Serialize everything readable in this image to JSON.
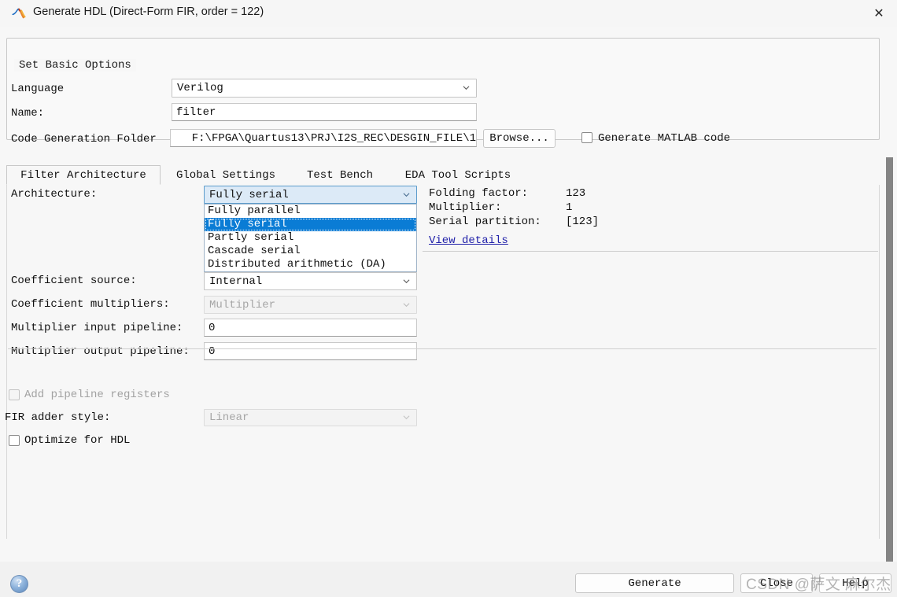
{
  "window": {
    "title": "Generate HDL (Direct-Form FIR, order = 122)",
    "logo_icon": "matlab-membrane-icon",
    "close_icon": "close-icon"
  },
  "basic_options": {
    "group_title": "Set Basic Options",
    "language_label": "Language",
    "language_value": "Verilog",
    "name_label": "Name:",
    "name_value": "filter",
    "folder_label": "Code Generation Folder",
    "folder_value": "F:\\FPGA\\Quartus13\\PRJ\\I2S_REC\\DESGIN_FILE\\1",
    "browse_label": "Browse...",
    "generate_matlab_label": "Generate MATLAB code",
    "generate_matlab_checked": false
  },
  "tabs": [
    {
      "label": "Filter Architecture",
      "active": true
    },
    {
      "label": "Global Settings",
      "active": false
    },
    {
      "label": "Test Bench",
      "active": false
    },
    {
      "label": "EDA Tool Scripts",
      "active": false
    }
  ],
  "architecture": {
    "label": "Architecture:",
    "value": "Fully serial",
    "options": [
      "Fully parallel",
      "Fully serial",
      "Partly serial",
      "Cascade serial",
      "Distributed arithmetic (DA)"
    ],
    "selected_index": 1,
    "expanded": true
  },
  "details": {
    "folding_factor_label": "Folding factor:",
    "folding_factor_value": "123",
    "multiplier_label": "Multiplier:",
    "multiplier_value": "1",
    "serial_partition_label": "Serial partition:",
    "serial_partition_value": "[123]",
    "view_details_link": "View details"
  },
  "fields": {
    "coefficient_source_label": "Coefficient source:",
    "coefficient_source_value": "Internal",
    "coefficient_multipliers_label": "Coefficient multipliers:",
    "coefficient_multipliers_value": "Multiplier",
    "coefficient_multipliers_disabled": true,
    "mult_input_pipeline_label": "Multiplier input pipeline:",
    "mult_input_pipeline_value": "0",
    "mult_output_pipeline_label": "Multiplier output pipeline:",
    "mult_output_pipeline_value": "0"
  },
  "options_lower": {
    "add_pipeline_label": "Add pipeline registers",
    "add_pipeline_checked": false,
    "add_pipeline_disabled": true,
    "fir_adder_style_label": "FIR adder style:",
    "fir_adder_style_value": "Linear",
    "fir_adder_style_disabled": true,
    "optimize_hdl_label": "Optimize for HDL",
    "optimize_hdl_checked": false
  },
  "footer": {
    "generate_label": "Generate",
    "close_label": "Close",
    "help_label": "Help",
    "help_icon": "question-mark-icon"
  },
  "watermark": {
    "text": "CSDN @萨文 麻尔杰"
  },
  "colors": {
    "accent_selection": "#0a7cd5",
    "focus_fill": "#dceaf7",
    "link": "#2222aa",
    "scrollbar": "#848484"
  }
}
